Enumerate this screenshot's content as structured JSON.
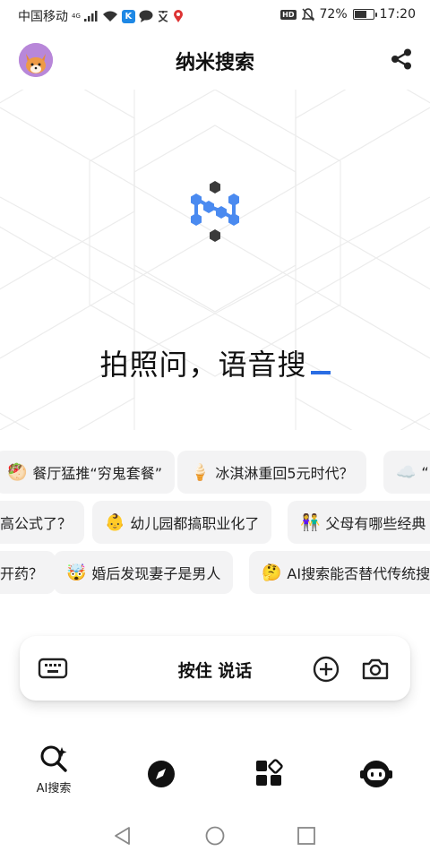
{
  "status_bar": {
    "carrier": "中国移动",
    "network": "4G",
    "hd": "HD",
    "battery_text": "72%",
    "battery_level": 0.72,
    "time": "17:20",
    "k_badge": "K"
  },
  "header": {
    "title": "纳米搜索"
  },
  "hero": {
    "prompt_text": "拍照问，语音搜"
  },
  "suggestion_rows": [
    [
      {
        "emoji": "🥙",
        "text": "餐厅猛推“穷鬼套餐”"
      },
      {
        "emoji": "🍦",
        "text": "冰淇淋重回5元时代？"
      },
      {
        "emoji": "☁️",
        "text": "“"
      }
    ],
    [
      {
        "emoji": "",
        "text": "高公式了？"
      },
      {
        "emoji": "👶",
        "text": "幼儿园都搞职业化了"
      },
      {
        "emoji": "👫",
        "text": "父母有哪些经典"
      }
    ],
    [
      {
        "emoji": "",
        "text": "开药？"
      },
      {
        "emoji": "🤯",
        "text": "婚后发现妻子是男人"
      },
      {
        "emoji": "🤔",
        "text": "AI搜索能否替代传统搜"
      }
    ]
  ],
  "input_bar": {
    "talk_label": "按住 说话"
  },
  "bottom_nav": [
    {
      "label": "AI搜索",
      "icon": "ai-search-icon"
    },
    {
      "label": "",
      "icon": "compass-icon"
    },
    {
      "label": "",
      "icon": "apps-icon"
    },
    {
      "label": "",
      "icon": "robot-icon"
    }
  ],
  "colors": {
    "accent": "#2a6de3",
    "logo_blue": "#4a8af0",
    "chip_bg": "#f3f3f4"
  }
}
